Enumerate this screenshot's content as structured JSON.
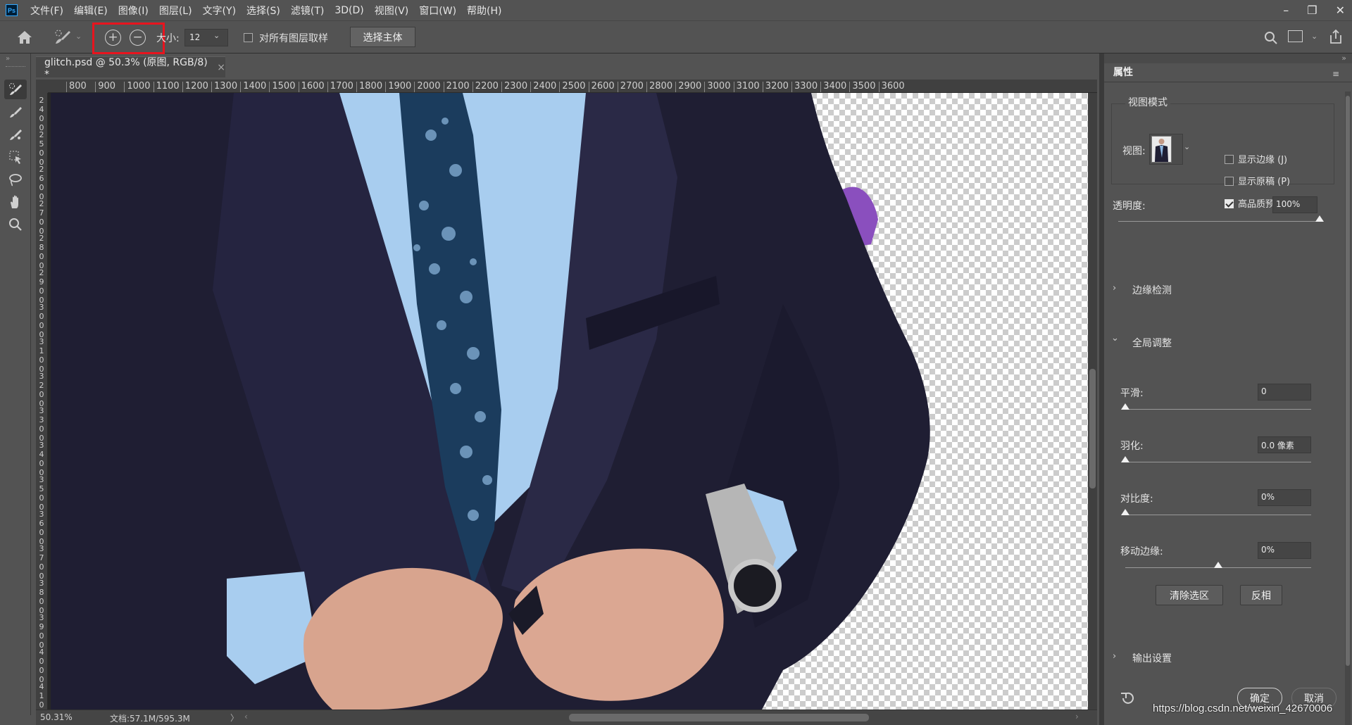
{
  "app": {
    "logo": "Ps"
  },
  "menu": [
    "文件(F)",
    "编辑(E)",
    "图像(I)",
    "图层(L)",
    "文字(Y)",
    "选择(S)",
    "滤镜(T)",
    "3D(D)",
    "视图(V)",
    "窗口(W)",
    "帮助(H)"
  ],
  "window_controls": {
    "minimize": "–",
    "restore": "❐",
    "close": "✕"
  },
  "options": {
    "size_label": "大小:",
    "size_value": "12",
    "sample_all_layers": "对所有图层取样",
    "select_subject": "选择主体"
  },
  "document": {
    "tab_title": "glitch.psd @ 50.3% (原图, RGB/8) *"
  },
  "ruler": {
    "h_ticks": [
      "800",
      "900",
      "1000",
      "1100",
      "1200",
      "1300",
      "1400",
      "1500",
      "1600",
      "1700",
      "1800",
      "1900",
      "2000",
      "2100",
      "2200",
      "2300",
      "2400",
      "2500",
      "2600",
      "2700",
      "2800",
      "2900",
      "3000",
      "3100",
      "3200",
      "3300",
      "3400",
      "3500",
      "3600"
    ],
    "v_ticks": [
      "2400",
      "2500",
      "2600",
      "2700",
      "2800",
      "2900",
      "3000",
      "3100",
      "3200",
      "3300",
      "3400",
      "3500",
      "3600",
      "3700",
      "3800",
      "3900",
      "4000",
      "4100"
    ]
  },
  "status": {
    "zoom": "50.31%",
    "doc_info": "文档:57.1M/595.3M",
    "arrow": "〉"
  },
  "panel": {
    "tab": "属性",
    "view_mode": {
      "section": "视图模式",
      "view_label": "视图:",
      "show_edge": "显示边缘 (J)",
      "show_original": "显示原稿 (P)",
      "hq_preview": "高品质预览 (W)",
      "show_edge_checked": false,
      "show_original_checked": false,
      "hq_preview_checked": true
    },
    "opacity": {
      "label": "透明度:",
      "value": "100%",
      "fraction": 1.0
    },
    "edge_detection": "边缘检测",
    "global_refine": {
      "section": "全局调整",
      "smooth": {
        "label": "平滑:",
        "value": "0",
        "fraction": 0.0
      },
      "feather": {
        "label": "羽化:",
        "value": "0.0 像素",
        "fraction": 0.0
      },
      "contrast": {
        "label": "对比度:",
        "value": "0%",
        "fraction": 0.0
      },
      "shift_edge": {
        "label": "移动边缘:",
        "value": "0%",
        "fraction": 0.5
      }
    },
    "clear_selection": "清除选区",
    "invert": "反相",
    "output_settings": "输出设置",
    "ok": "确定",
    "cancel": "取消"
  },
  "watermark": "https://blog.csdn.net/weixin_42670006",
  "colors": {
    "suit": "#1f1f33",
    "shirt": "#a9cdf0",
    "tie": "#1c3e5f",
    "purple_bg": "#8c53c0",
    "selection_box": "#e8141e"
  }
}
